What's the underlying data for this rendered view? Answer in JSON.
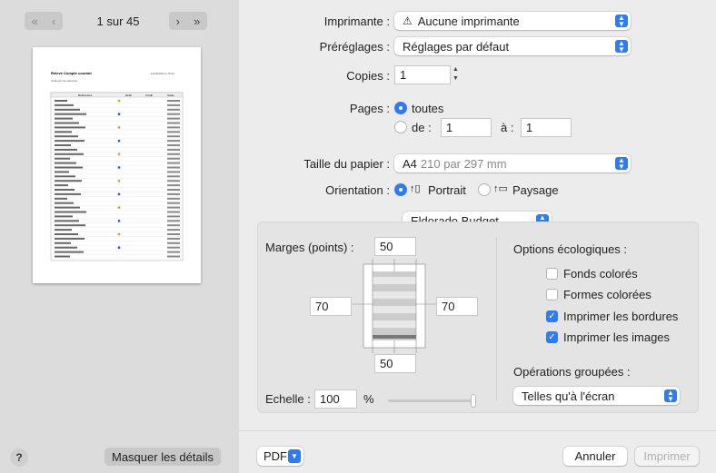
{
  "preview": {
    "page_indicator": "1 sur 45",
    "nav_first": "«",
    "nav_prev": "‹",
    "nav_next": "›",
    "nav_last": "»",
    "help": "?",
    "hide_details": "Masquer les détails",
    "doc_title": "Relevé Compte courant",
    "doc_date": "12/09/2022 à 15:04",
    "doc_subtitle": "Critère(s) de sélection :",
    "col_headers": [
      "Références",
      "Débit",
      "Crédit",
      "Solde"
    ]
  },
  "settings": {
    "printer_label": "Imprimante :",
    "printer_value": "Aucune imprimante",
    "presets_label": "Préréglages :",
    "presets_value": "Réglages par défaut",
    "copies_label": "Copies :",
    "copies_value": "1",
    "pages_label": "Pages :",
    "pages_all": "toutes",
    "pages_from": "de :",
    "pages_from_value": "1",
    "pages_to": "à :",
    "pages_to_value": "1",
    "paper_label": "Taille du papier :",
    "paper_value": "A4",
    "paper_dims": "210 par 297 mm",
    "orientation_label": "Orientation :",
    "orientation_portrait": "Portrait",
    "orientation_landscape": "Paysage",
    "app_popup": "Eldorado Budget"
  },
  "app_options": {
    "margins_label": "Marges (points) :",
    "margin_top": "50",
    "margin_left": "70",
    "margin_right": "70",
    "margin_bottom": "50",
    "scale_label": "Echelle :",
    "scale_value": "100",
    "scale_unit": "%",
    "eco_label": "Options écologiques :",
    "eco_options": [
      {
        "label": "Fonds colorés",
        "checked": false
      },
      {
        "label": "Formes colorées",
        "checked": false
      },
      {
        "label": "Imprimer les bordures",
        "checked": true
      },
      {
        "label": "Imprimer les images",
        "checked": true
      }
    ],
    "grouped_label": "Opérations groupées :",
    "grouped_value": "Telles qu'à l'écran"
  },
  "footer": {
    "pdf": "PDF",
    "cancel": "Annuler",
    "print": "Imprimer"
  },
  "colors": {
    "accent": "#2f7bf6"
  }
}
